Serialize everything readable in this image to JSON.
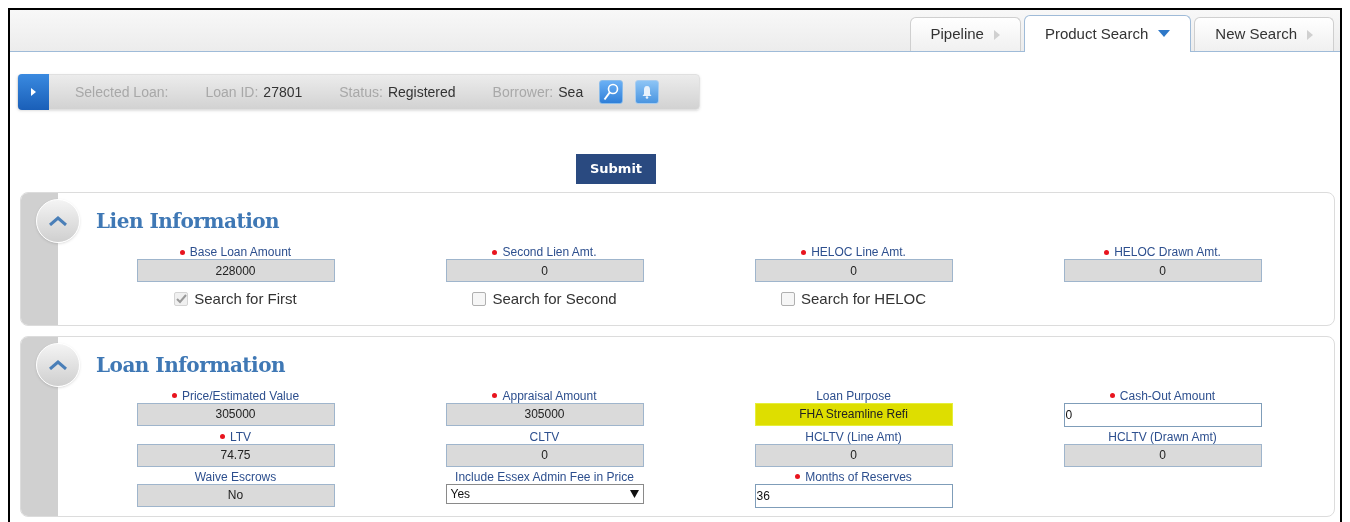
{
  "tabs": [
    {
      "label": "Pipeline",
      "selected": false
    },
    {
      "label": "Product Search",
      "selected": true
    },
    {
      "label": "New Search",
      "selected": false
    }
  ],
  "loan_bar": {
    "items": [
      {
        "label": "Selected Loan:"
      },
      {
        "label": "Loan ID:",
        "value": "27801"
      },
      {
        "label": "Status:",
        "value": "Registered"
      },
      {
        "label": "Borrower:",
        "value": "Sea"
      }
    ]
  },
  "submit_button": "Submit",
  "sections": [
    {
      "title": "Lien Information",
      "expanded": true,
      "fields": [
        {
          "label": "Base Loan Amount",
          "required": true,
          "kind": "readonly",
          "value": "228000",
          "option": {
            "label": "Search for First",
            "checked": true,
            "disabled": true
          }
        },
        {
          "label": "Second Lien Amt.",
          "required": true,
          "kind": "readonly",
          "value": "0",
          "option": {
            "label": "Search for Second",
            "checked": false,
            "disabled": false
          }
        },
        {
          "label": "HELOC Line Amt.",
          "required": true,
          "kind": "readonly",
          "value": "0",
          "option": {
            "label": "Search for HELOC",
            "checked": false,
            "disabled": false
          }
        },
        {
          "label": "HELOC Drawn Amt.",
          "required": true,
          "kind": "readonly",
          "value": "0"
        }
      ]
    },
    {
      "title": "Loan Information",
      "expanded": true,
      "fields": [
        {
          "label": "Price/Estimated Value",
          "required": true,
          "kind": "readonly",
          "value": "305000"
        },
        {
          "label": "Appraisal Amount",
          "required": true,
          "kind": "readonly",
          "value": "305000"
        },
        {
          "label": "Loan Purpose",
          "required": false,
          "kind": "highlighted",
          "value": "FHA Streamline Refi"
        },
        {
          "label": "Cash-Out Amount",
          "required": true,
          "kind": "input",
          "value": "0"
        },
        {
          "label": "LTV",
          "required": true,
          "kind": "readonly",
          "value": "74.75"
        },
        {
          "label": "CLTV",
          "required": false,
          "kind": "readonly",
          "value": "0"
        },
        {
          "label": "HCLTV (Line Amt)",
          "required": false,
          "kind": "readonly",
          "value": "0"
        },
        {
          "label": "HCLTV (Drawn Amt)",
          "required": false,
          "kind": "readonly",
          "value": "0"
        },
        {
          "label": "Waive Escrows",
          "required": false,
          "kind": "readonly",
          "value": "No"
        },
        {
          "label": "Include Essex Admin Fee in Price",
          "required": false,
          "kind": "select",
          "value": "Yes"
        },
        {
          "label": "Months of Reserves",
          "required": true,
          "kind": "input",
          "value": "36"
        }
      ]
    }
  ]
}
